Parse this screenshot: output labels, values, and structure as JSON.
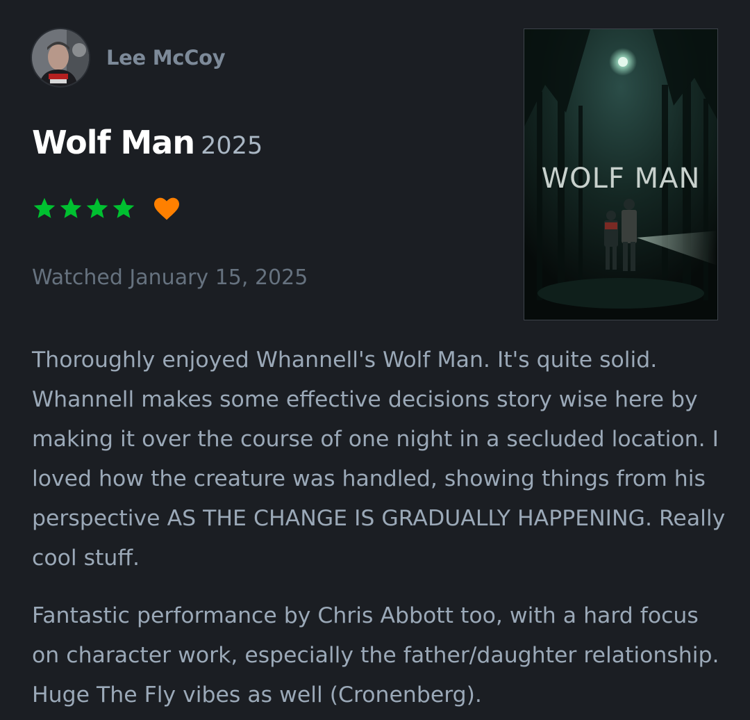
{
  "reviewer": {
    "name": "Lee McCoy",
    "avatar_icon": "avatar-photo"
  },
  "film": {
    "title": "Wolf Man",
    "year": "2025",
    "poster_text": "WOLF MAN"
  },
  "rating": {
    "stars": 4,
    "max_stars": 5,
    "liked": true,
    "star_color": "#00c030",
    "heart_color": "#ff8000",
    "star_icon": "star-icon",
    "heart_icon": "heart-icon"
  },
  "watched_label": "Watched January 15, 2025",
  "review": {
    "paragraphs": [
      "Thoroughly enjoyed Whannell's Wolf Man. It's quite solid. Whannell makes some effective decisions story wise here by making it over the course of one night in a secluded location. I loved how the creature was handled, showing things from his perspective AS THE CHANGE IS GRADUALLY HAPPENING. Really cool stuff.",
      "Fantastic performance by Chris Abbott too, with a hard focus on character work, especially the father/daughter relationship. Huge The Fly vibes as well (Cronenberg)."
    ]
  },
  "colors": {
    "background": "#1b1e23",
    "text": "#9ba9b8",
    "muted": "#66727f",
    "title": "#ffffff"
  }
}
